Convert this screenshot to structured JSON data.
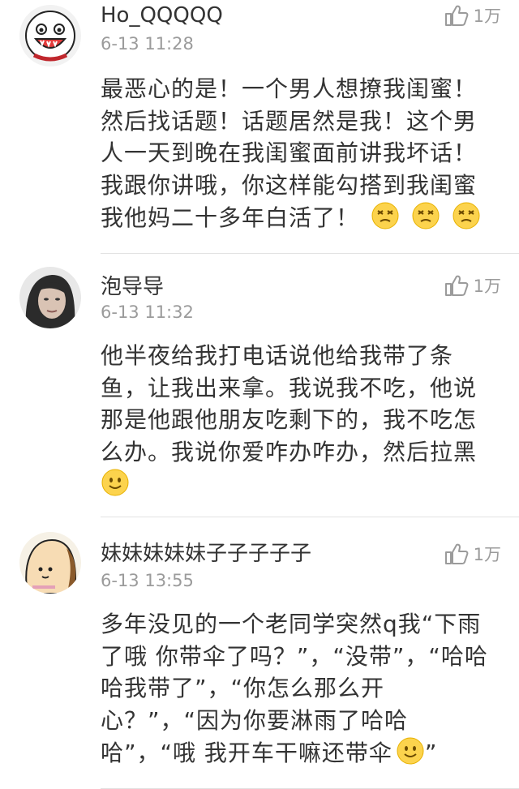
{
  "comments": [
    {
      "username": "Ho_QQQQQ",
      "time": "6-13 11:28",
      "likes": "1万",
      "avatar": "cartoon-mascot-avatar",
      "lines": [
        "最恶心的是！一个男人想撩我闺蜜！",
        "然后找话题！话题居然是我！这个男",
        "人一天到晚在我闺蜜面前讲我坏话！",
        "我跟你讲哦，你这样能勾搭到我闺蜜",
        "我他妈二十多年白活了！"
      ],
      "emoji": "dizzy-face-emoji"
    },
    {
      "username": "泡导导",
      "time": "6-13 11:32",
      "likes": "1万",
      "avatar": "woman-photo-avatar",
      "lines": [
        "他半夜给我打电话说他给我带了条",
        "鱼，让我出来拿。我说我不吃，他说",
        "那是他跟他朋友吃剩下的，我不吃怎",
        "么办。我说你爱咋办咋办，然后拉黑"
      ],
      "emoji": "smile-emoji"
    },
    {
      "username": "妹妹妹妹妹子子子子子",
      "time": "6-13 13:55",
      "likes": "1万",
      "avatar": "cartoon-face-avatar",
      "lines": [
        "多年没见的一个老同学突然q我“下雨",
        "了哦 你带伞了吗？”，“没带”，“哈哈",
        "哈我带了”，“你怎么那么开",
        "心？”，“因为你要淋雨了哈哈",
        "哈”，“哦 我开车干嘛还带伞"
      ],
      "last_suffix": "”",
      "emoji": "smile-emoji"
    }
  ]
}
